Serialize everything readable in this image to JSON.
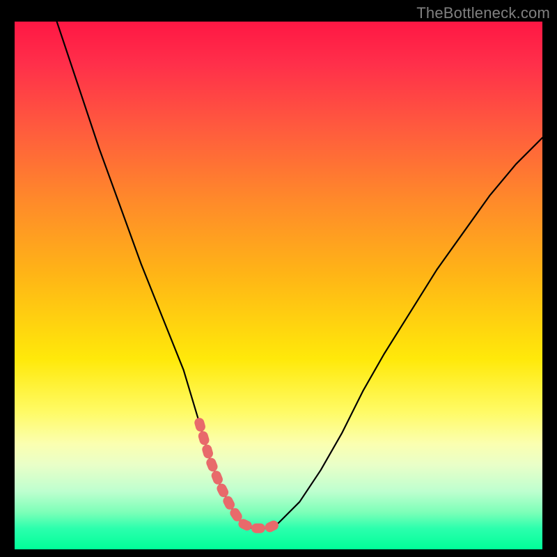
{
  "watermark": "TheBottleneck.com",
  "colors": {
    "background": "#000000",
    "gradient_top": "#ff1744",
    "gradient_mid": "#ffe90a",
    "gradient_bottom": "#00ff99",
    "curve": "#000000",
    "dotted_highlight": "#e86a6b"
  },
  "chart_data": {
    "type": "line",
    "title": "",
    "xlabel": "",
    "ylabel": "",
    "xlim": [
      0,
      100
    ],
    "ylim": [
      0,
      100
    ],
    "grid": false,
    "series": [
      {
        "name": "bottleneck-curve",
        "x": [
          8,
          12,
          16,
          20,
          24,
          28,
          32,
          35,
          37,
          39,
          41,
          43,
          45,
          48,
          50,
          54,
          58,
          62,
          66,
          70,
          75,
          80,
          85,
          90,
          95,
          100
        ],
        "y": [
          100,
          88,
          76,
          65,
          54,
          44,
          34,
          24,
          17,
          12,
          8,
          5,
          4,
          4,
          5,
          9,
          15,
          22,
          30,
          37,
          45,
          53,
          60,
          67,
          73,
          78
        ]
      }
    ],
    "annotations": [
      {
        "name": "valley-highlight",
        "style": "dotted",
        "color": "#e86a6b",
        "x": [
          35,
          37,
          39,
          41,
          43,
          45,
          48,
          50
        ],
        "y": [
          24,
          17,
          12,
          8,
          5,
          4,
          4,
          5
        ]
      }
    ]
  }
}
